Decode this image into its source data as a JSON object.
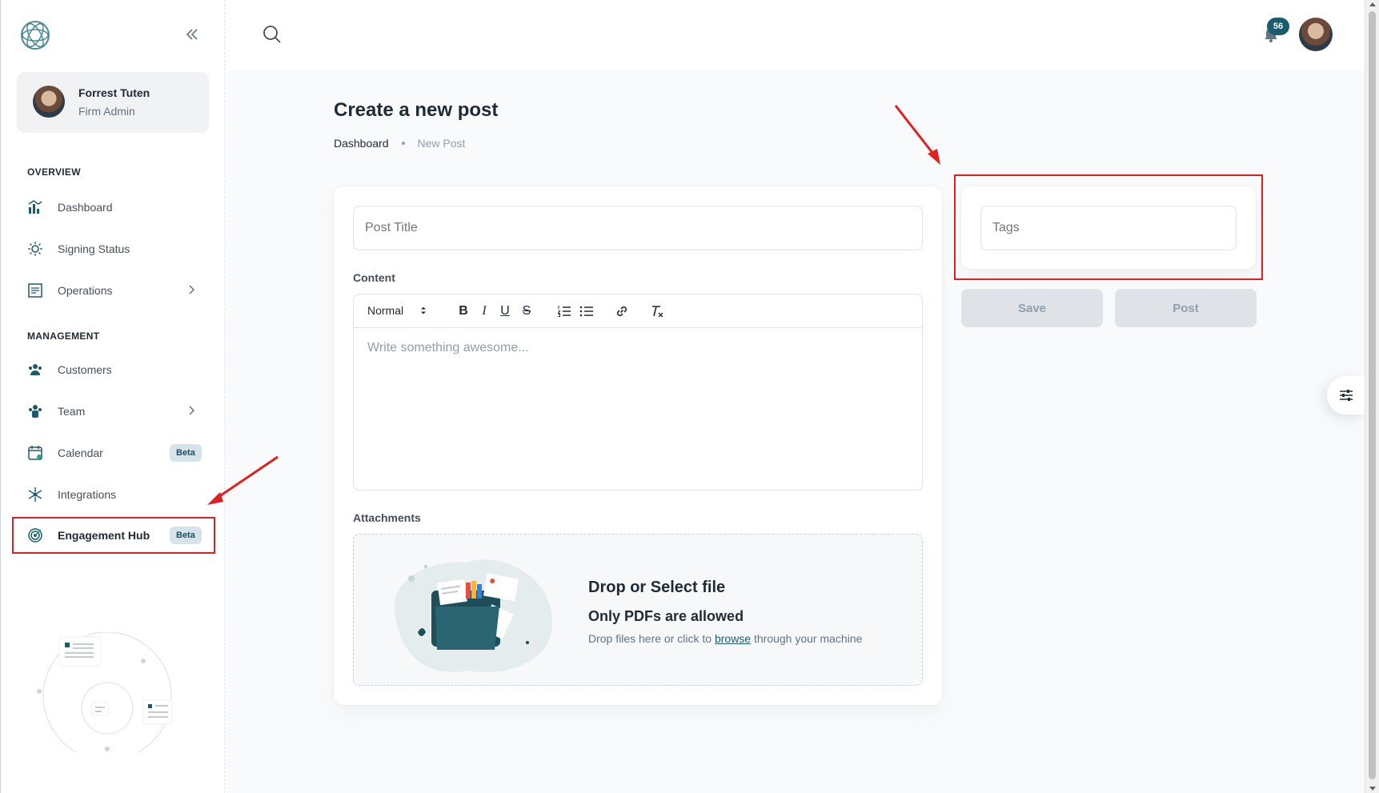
{
  "user": {
    "name": "Forrest Tuten",
    "role": "Firm Admin"
  },
  "sidebar": {
    "sections": [
      {
        "label": "OVERVIEW"
      },
      {
        "label": "MANAGEMENT"
      }
    ],
    "items": [
      {
        "label": "Dashboard",
        "icon": "dashboard-icon"
      },
      {
        "label": "Signing Status",
        "icon": "signing-icon"
      },
      {
        "label": "Operations",
        "icon": "operations-icon",
        "expandable": true
      },
      {
        "label": "Customers",
        "icon": "customers-icon"
      },
      {
        "label": "Team",
        "icon": "team-icon",
        "expandable": true
      },
      {
        "label": "Calendar",
        "icon": "calendar-icon",
        "badge": "Beta"
      },
      {
        "label": "Integrations",
        "icon": "integrations-icon"
      },
      {
        "label": "Engagement Hub",
        "icon": "target-icon",
        "badge": "Beta",
        "highlighted": true
      }
    ]
  },
  "topbar": {
    "notifications_count": "56"
  },
  "page": {
    "title": "Create a new post",
    "breadcrumb": [
      "Dashboard",
      "New Post"
    ]
  },
  "form": {
    "title_placeholder": "Post Title",
    "content_label": "Content",
    "editor": {
      "format_select": "Normal",
      "placeholder": "Write something awesome..."
    },
    "attachments_label": "Attachments",
    "dropzone": {
      "title": "Drop or Select file",
      "subtitle": "Only PDFs are allowed",
      "hint_before": "Drop files here or click to ",
      "hint_link": "browse",
      "hint_after": " through your machine"
    },
    "tags_placeholder": "Tags",
    "save_label": "Save",
    "post_label": "Post"
  },
  "colors": {
    "accent": "#1c5b6b",
    "highlight": "#e02020"
  }
}
